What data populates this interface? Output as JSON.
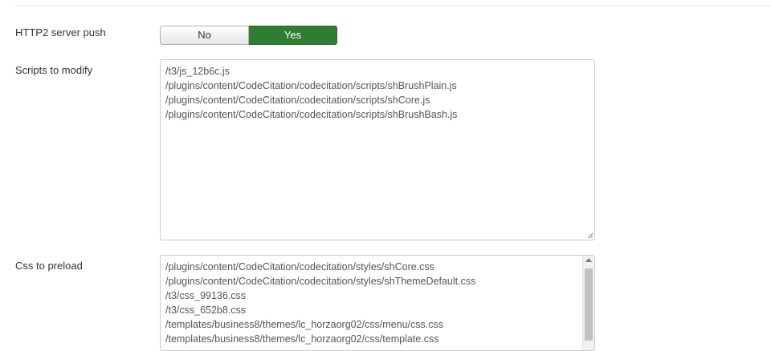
{
  "http2_push": {
    "label": "HTTP2 server push",
    "options": [
      "No",
      "Yes"
    ],
    "selected": "Yes"
  },
  "scripts": {
    "label": "Scripts to modify",
    "lines": [
      "/t3/js_12b6c.js",
      "/plugins/content/CodeCitation/codecitation/scripts/shBrushPlain.js",
      "/plugins/content/CodeCitation/codecitation/scripts/shCore.js",
      "/plugins/content/CodeCitation/codecitation/scripts/shBrushBash.js"
    ]
  },
  "css_preload": {
    "label": "Css to preload",
    "lines": [
      "/plugins/content/CodeCitation/codecitation/styles/shCore.css",
      "/plugins/content/CodeCitation/codecitation/styles/shThemeDefault.css",
      "/t3/css_99136.css",
      "/t3/css_652b8.css",
      "/templates/business8/themes/lc_horzaorg02/css/menu/css.css",
      "/templates/business8/themes/lc_horzaorg02/css/template.css"
    ]
  },
  "colors": {
    "active_green": "#2f7d32"
  }
}
